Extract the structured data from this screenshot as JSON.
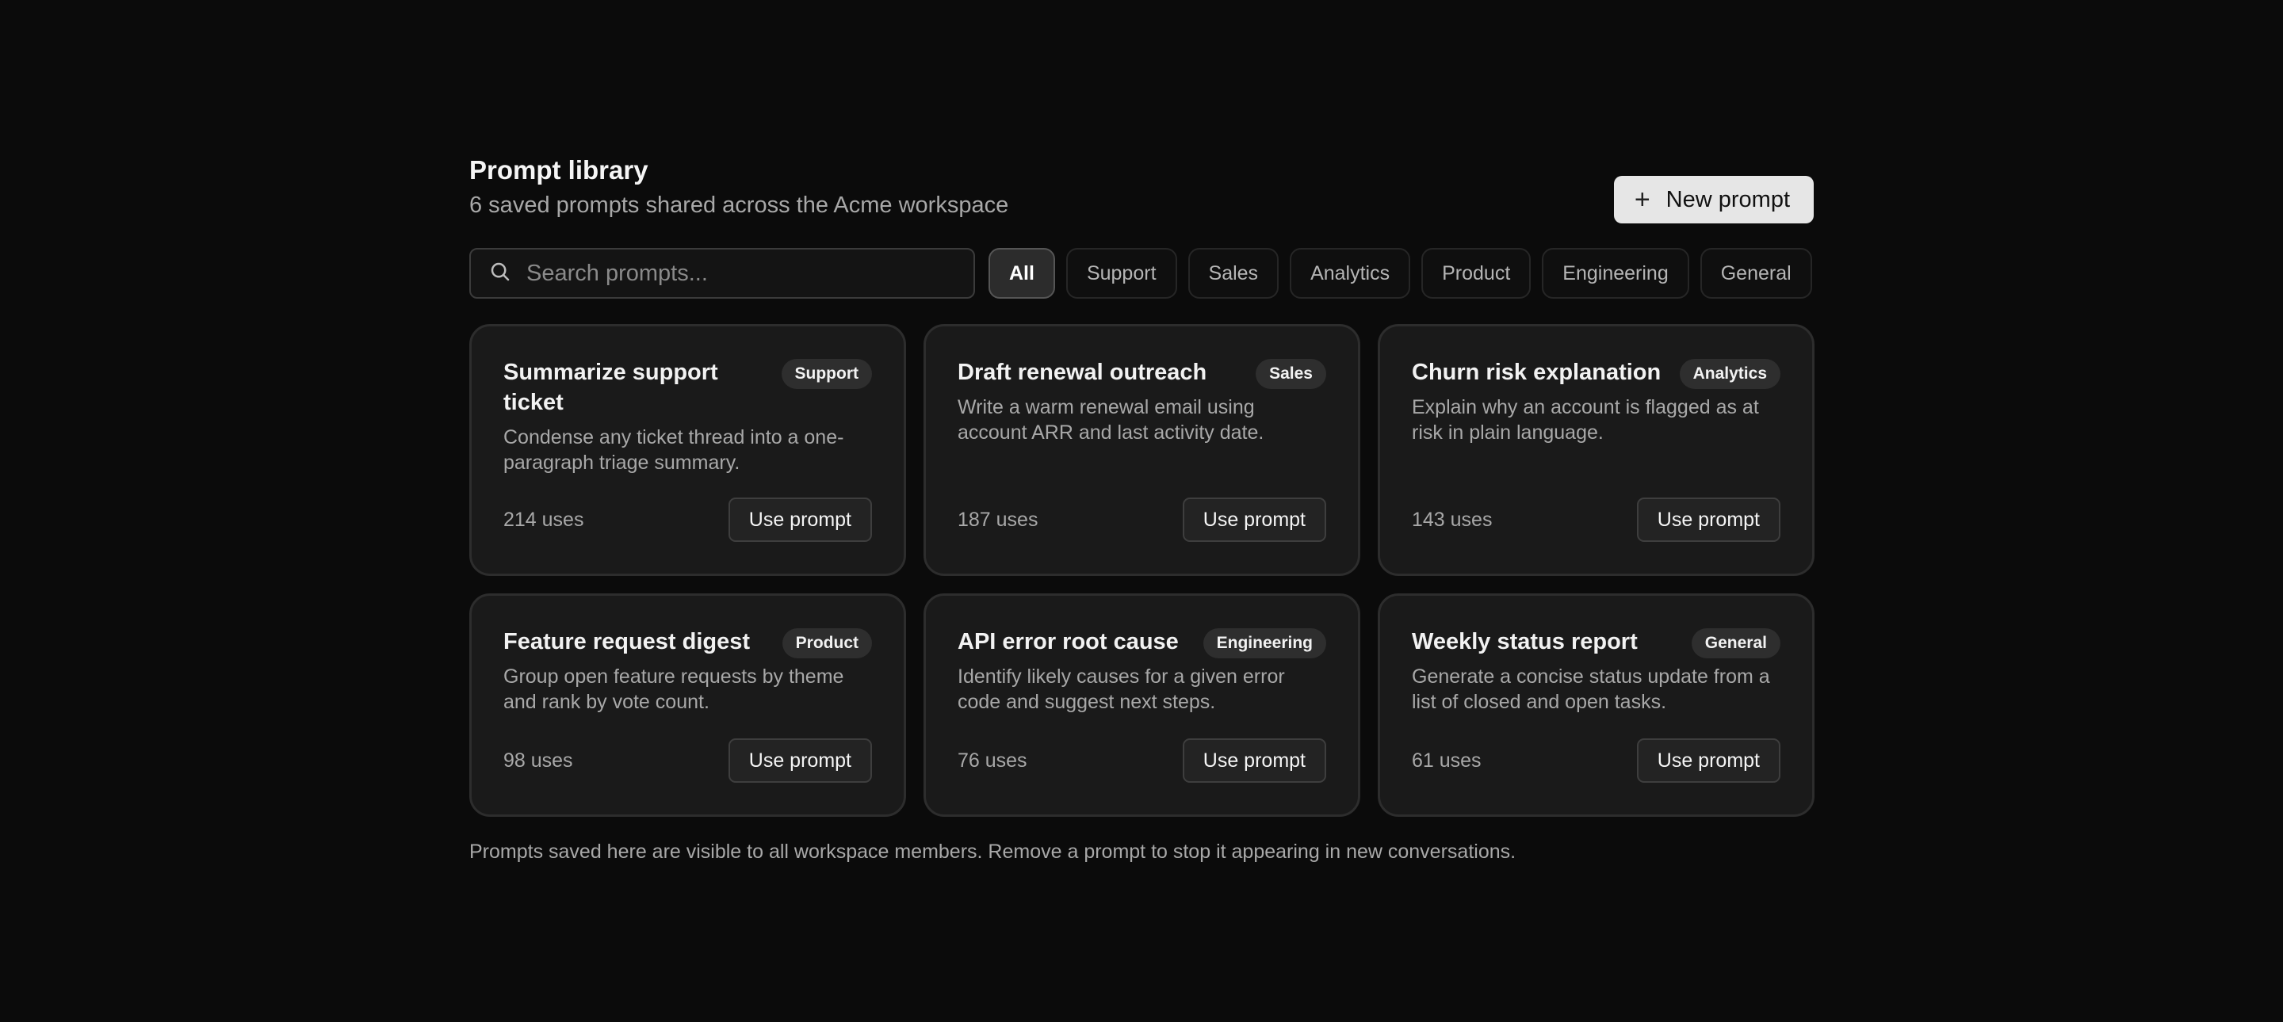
{
  "header": {
    "title": "Prompt library",
    "subtitle": "6 saved prompts shared across the Acme workspace",
    "new_button_label": "New prompt",
    "new_button_icon": "plus-icon"
  },
  "search": {
    "placeholder": "Search prompts...",
    "value": "",
    "icon": "search-icon"
  },
  "filters": {
    "active": "All",
    "items": [
      "All",
      "Support",
      "Sales",
      "Analytics",
      "Product",
      "Engineering",
      "General"
    ]
  },
  "prompts": [
    {
      "title": "Summarize support ticket",
      "category": "Support",
      "description": "Condense any ticket thread into a one-paragraph triage summary.",
      "uses": "214 uses",
      "action": "Use prompt"
    },
    {
      "title": "Draft renewal outreach",
      "category": "Sales",
      "description": "Write a warm renewal email using account ARR and last activity date.",
      "uses": "187 uses",
      "action": "Use prompt"
    },
    {
      "title": "Churn risk explanation",
      "category": "Analytics",
      "description": "Explain why an account is flagged as at risk in plain language.",
      "uses": "143 uses",
      "action": "Use prompt"
    },
    {
      "title": "Feature request digest",
      "category": "Product",
      "description": "Group open feature requests by theme and rank by vote count.",
      "uses": "98 uses",
      "action": "Use prompt"
    },
    {
      "title": "API error root cause",
      "category": "Engineering",
      "description": "Identify likely causes for a given error code and suggest next steps.",
      "uses": "76 uses",
      "action": "Use prompt"
    },
    {
      "title": "Weekly status report",
      "category": "General",
      "description": "Generate a concise status update from a list of closed and open tasks.",
      "uses": "61 uses",
      "action": "Use prompt"
    }
  ],
  "footnote": "Prompts saved here are visible to all workspace members. Remove a prompt to stop it appearing in new conversations.",
  "colors": {
    "background": "#0b0b0b",
    "card": "#1a1a1a",
    "primary_button": "#e6e6e6"
  }
}
